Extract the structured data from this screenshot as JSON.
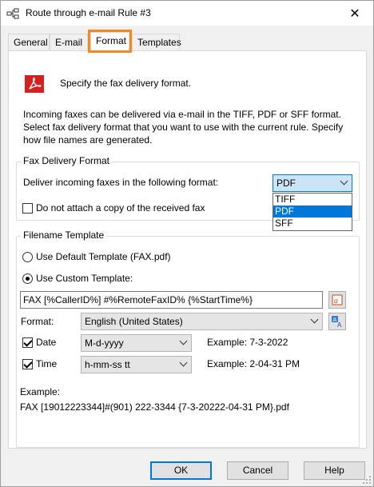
{
  "window": {
    "title": "Route through e-mail Rule #3",
    "close_glyph": "✕"
  },
  "tabs": [
    {
      "label": "General",
      "active": false
    },
    {
      "label": "E-mail",
      "active": false
    },
    {
      "label": "Format",
      "active": true
    },
    {
      "label": "Templates",
      "active": false
    }
  ],
  "header": {
    "icon": "pdf-icon",
    "text": "Specify the fax delivery format."
  },
  "description": {
    "line1": "Incoming faxes can be delivered via e-mail in the TIFF, PDF or SFF format.",
    "line2": "Select fax delivery format that you want to use with the current rule. Specify",
    "line3": "how file names are generated."
  },
  "fax_delivery": {
    "legend": "Fax Delivery Format",
    "format_label": "Deliver incoming faxes in the following format:",
    "format_value": "PDF",
    "format_options": [
      "TIFF",
      "PDF",
      "SFF"
    ],
    "dropdown_open": true,
    "no_attach_label": "Do not attach a copy of the received fax",
    "no_attach_checked": false
  },
  "filename_template": {
    "legend": "Filename Template",
    "default_label": "Use Default Template (FAX.pdf)",
    "default_selected": false,
    "custom_label": "Use Custom Template:",
    "custom_selected": true,
    "template_value": "FAX [%CallerID%] #%RemoteFaxID% {%StartTime%}",
    "format_label": "Format:",
    "format_value": "English (United States)",
    "date_label": "Date",
    "date_checked": true,
    "date_value": "M-d-yyyy",
    "date_example": "Example: 7-3-2022",
    "time_label": "Time",
    "time_checked": true,
    "time_value": "h-mm-ss tt",
    "time_example": "Example: 2-04-31 PM",
    "example_label": "Example:",
    "example_value": "FAX [19012223344]#(901) 222-3344 {7-3-20222-04-31 PM}.pdf"
  },
  "buttons": {
    "ok": "OK",
    "cancel": "Cancel",
    "help": "Help"
  },
  "colors": {
    "accent": "#0078d7",
    "tab_highlight": "#f08a24",
    "pdf_red": "#d4211e"
  }
}
